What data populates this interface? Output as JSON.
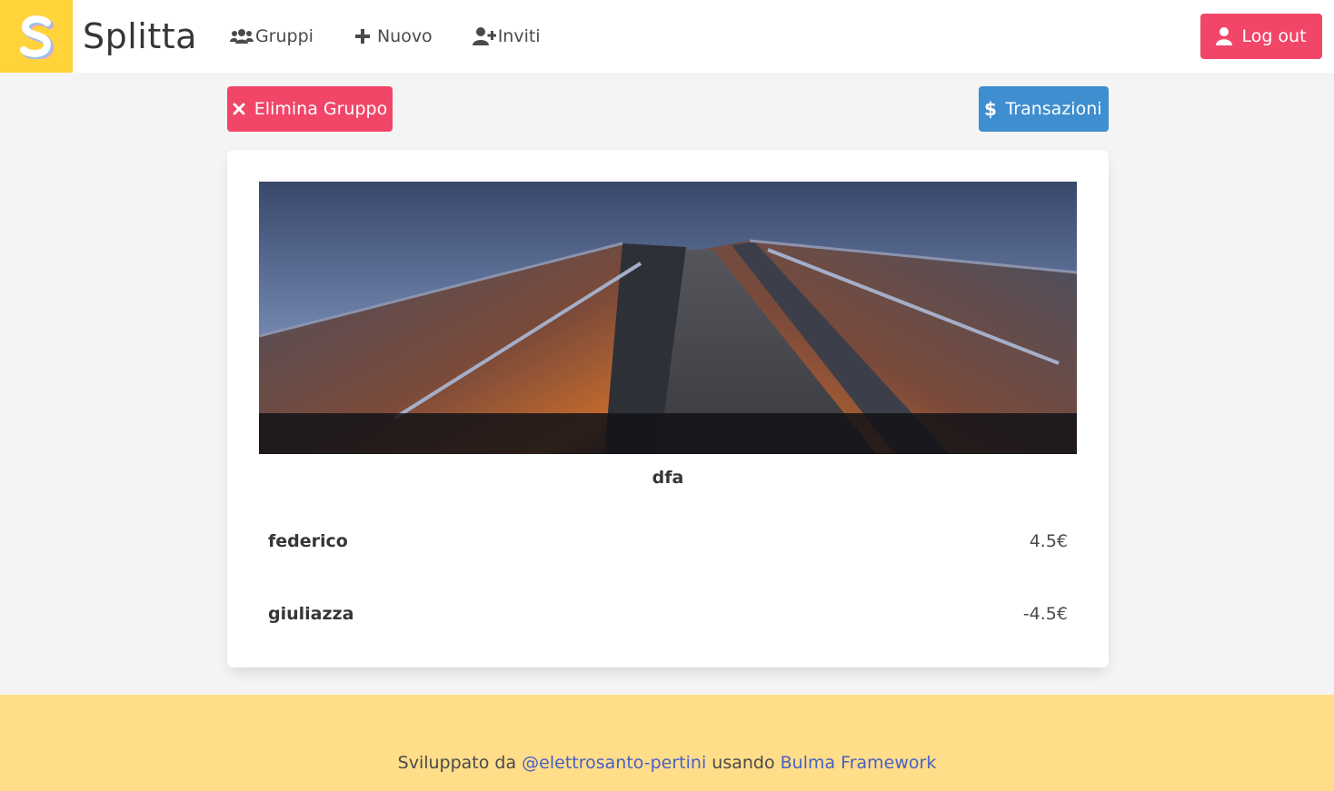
{
  "navbar": {
    "brand": "Splitta",
    "logo_letter": "S",
    "items": [
      {
        "label": "Gruppi",
        "icon": "users-icon"
      },
      {
        "label": "Nuovo",
        "icon": "plus-icon"
      },
      {
        "label": "Inviti",
        "icon": "user-plus-icon"
      }
    ],
    "logout_label": "Log out"
  },
  "actions": {
    "delete_label": "Elimina Gruppo",
    "transactions_label": "Transazioni"
  },
  "group": {
    "name": "dfa",
    "members": [
      {
        "name": "federico",
        "balance": "4.5€"
      },
      {
        "name": "giuliazza",
        "balance": "-4.5€"
      }
    ]
  },
  "footer": {
    "prefix": "Sviluppato da ",
    "author_link": "@elettrosanto-pertini",
    "middle": " usando ",
    "framework_link": "Bulma Framework"
  },
  "colors": {
    "primary_yellow": "#ffd43b",
    "danger": "#f14668",
    "info": "#3e8ed0",
    "footer_bg": "#ffdd89",
    "link": "#485fc7"
  }
}
